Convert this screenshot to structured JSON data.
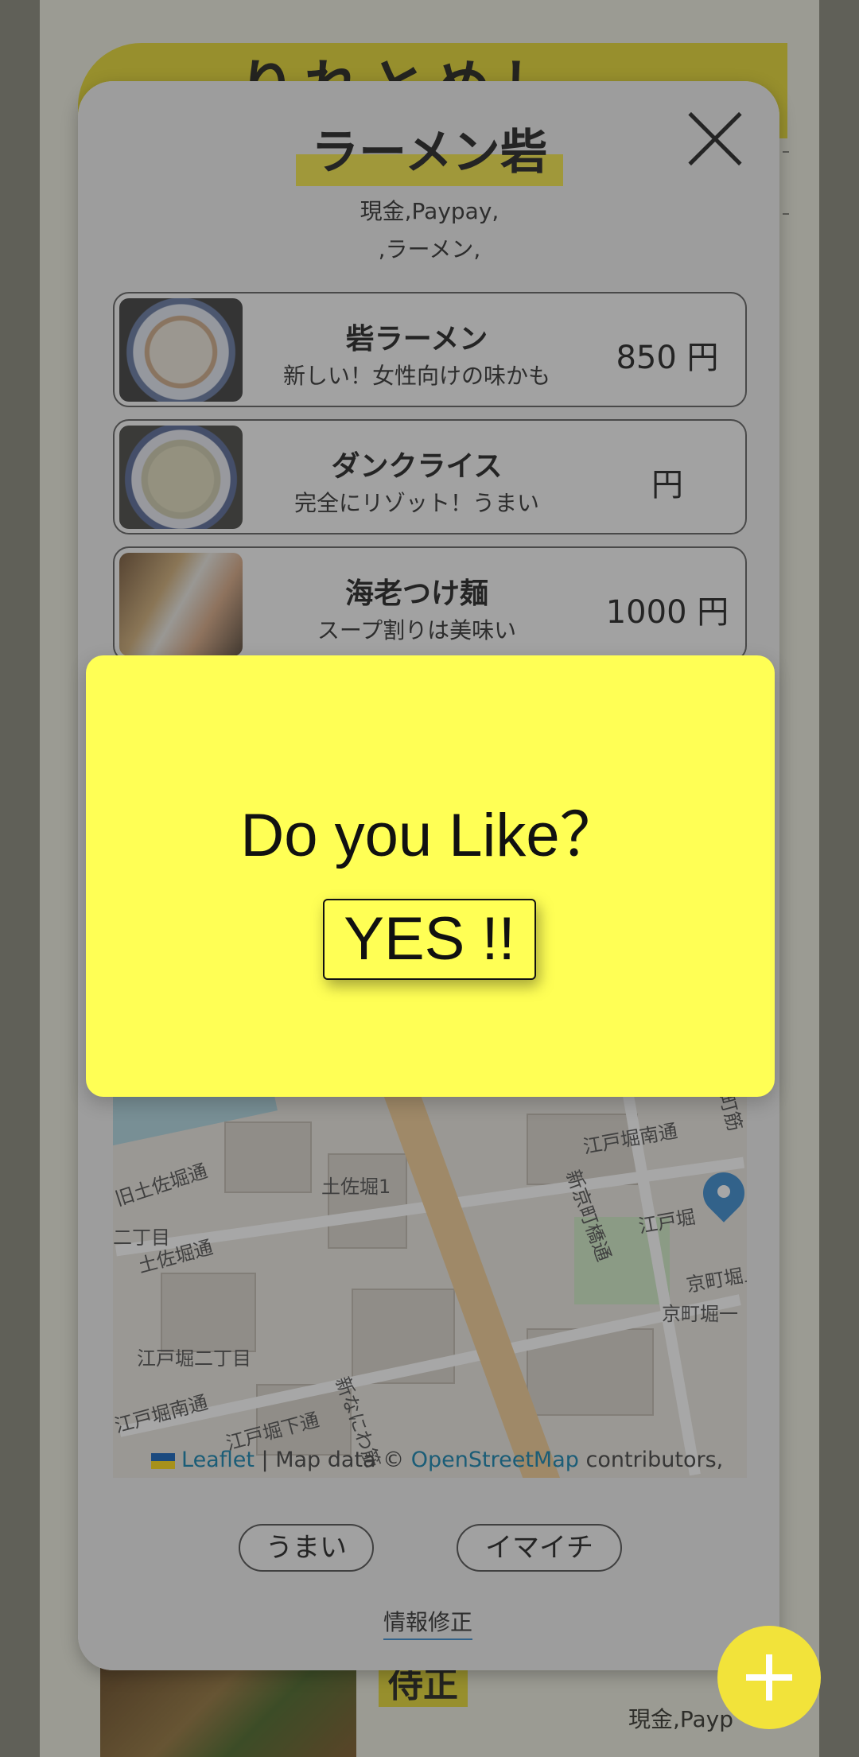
{
  "background": {
    "logo_text": "りれとめし",
    "card_title": "侍正",
    "card_sub": "現金,Payp"
  },
  "modal": {
    "shop_name": "ラーメン砦",
    "payment": "現金,Paypay,",
    "genre": ",ラーメン,",
    "menu": [
      {
        "name": "砦ラーメン",
        "desc": "新しい！女性向けの味かも",
        "price": "850 円"
      },
      {
        "name": "ダンクライス",
        "desc": "完全にリゾット！うまい",
        "price": "円"
      },
      {
        "name": "海老つけ麺",
        "desc": "スープ割りは美味い",
        "price": "1000 円"
      }
    ],
    "map": {
      "labels": [
        "土佐堀1",
        "江戸堀南通",
        "旧土佐堀通",
        "二丁目",
        "土佐堀通",
        "江戸堀",
        "京町堀上",
        "京町堀一",
        "江戸堀二丁目",
        "江戸堀南通",
        "江戸堀下通",
        "新なにわ筋",
        "新京町橋通",
        "町筋"
      ],
      "attribution_leaflet": "Leaflet",
      "attribution_mid": " | Map data © ",
      "attribution_osm": "OpenStreetMap",
      "attribution_end": " contributors,"
    },
    "vote_good": "うまい",
    "vote_bad": "イマイチ",
    "edit_link": "情報修正"
  },
  "prompt": {
    "question": "Do you Like？",
    "yes": "YES !!"
  },
  "colors": {
    "accent_yellow": "#f2e33a",
    "prompt_yellow": "#ffff55",
    "map_pin": "#2a81cb"
  }
}
